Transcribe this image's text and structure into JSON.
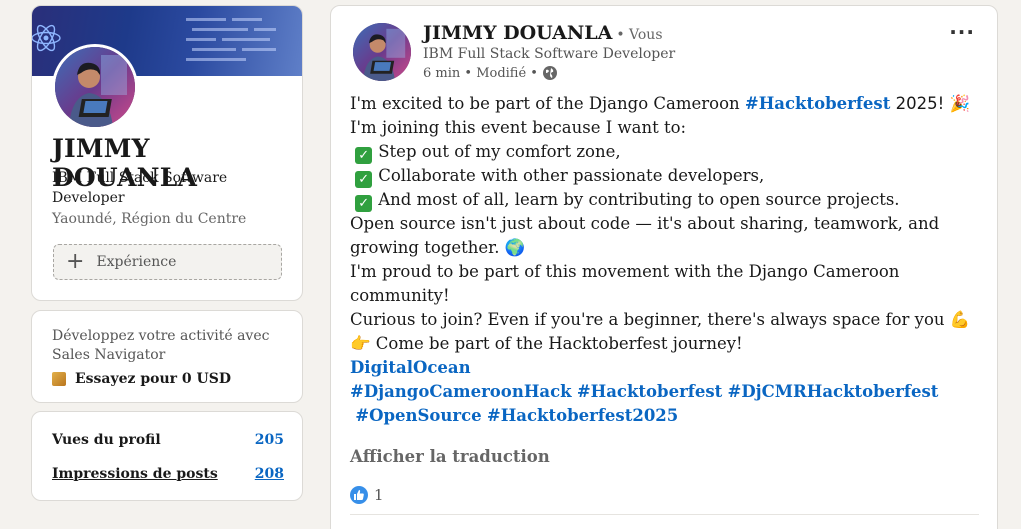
{
  "profile": {
    "name": "JIMMY DOUANLA",
    "headline": "IBM Full Stack Software Developer",
    "location": "Yaoundé, Région du Centre",
    "experience_button": "Expérience"
  },
  "sales": {
    "text": "Développez votre activité avec Sales Navigator",
    "cta": "Essayez pour 0 USD"
  },
  "stats": {
    "views_label": "Vues du profil",
    "views_value": "205",
    "impressions_label": "Impressions de posts",
    "impressions_value": "208"
  },
  "post": {
    "author": "JIMMY DOUANLA",
    "you": "• Vous",
    "headline": "IBM Full Stack Software Developer",
    "meta": "6 min • Modifié •",
    "more": "···",
    "body": {
      "l1_pre": "I'm excited to be part of the Django Cameroon ",
      "l1_tag": "#Hacktoberfest",
      "l1_post": " 2025! 🎉",
      "l2": "I'm joining this event because I want to:",
      "l3": "Step out of my comfort zone,",
      "l4": "Collaborate with other passionate developers,",
      "l5": "And most of all, learn by contributing to open source projects.",
      "l6": "Open source isn't just about code — it's about sharing, teamwork, and growing together. 🌍",
      "l7": " I'm proud to be part of this movement with the Django Cameroon community!",
      "l8": "Curious to join? Even if you're a beginner, there's always space for you 💪",
      "l9": " 👉 Come be part of the Hacktoberfest journey!",
      "tag_do": "DigitalOcean",
      "tags1": [
        "#DjangoCameroonHack",
        "#Hacktoberfest",
        "#DjCMRHacktoberfest"
      ],
      "tags2": [
        "#OpenSource",
        "#Hacktoberfest2025"
      ]
    },
    "translate": "Afficher la traduction",
    "reaction_count": "1"
  },
  "colors": {
    "link": "#0a66c2",
    "like": "#378fe9",
    "background": "#f4f2ee"
  }
}
